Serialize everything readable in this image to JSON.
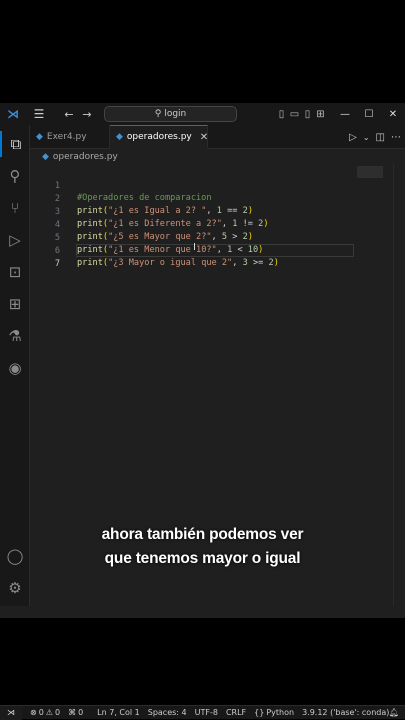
{
  "search": {
    "label": "login"
  },
  "tabs": [
    {
      "label": "Exer4.py",
      "active": false
    },
    {
      "label": "operadores.py",
      "active": true
    }
  ],
  "breadcrumb": {
    "file": "operadores.py"
  },
  "editor": {
    "lines": [
      {
        "num": "1",
        "text": "#Operadores de comparacion"
      },
      {
        "num": "2",
        "text": "print(\"¿1 es Igual a 2? \", 1 == 2)"
      },
      {
        "num": "3",
        "text": "print(\"¿1 es Diferente a 2?\", 1 != 2)"
      },
      {
        "num": "4",
        "text": "print(\"¿5 es Mayor que 2?\", 5 > 2)"
      },
      {
        "num": "5",
        "text": "print(\"¿1 es Menor que 10?\", 1 < 10)"
      },
      {
        "num": "6",
        "text": "print(\"¿3 Mayor o igual que 2\", 3 >= 2)"
      },
      {
        "num": "7",
        "text": ""
      }
    ]
  },
  "subtitle": {
    "line1": "ahora también podemos ver",
    "line2": "que tenemos mayor o igual"
  },
  "statusbar": {
    "errors": "0",
    "warnings": "0",
    "ports": "0",
    "position": "Ln 7, Col 1",
    "spaces": "Spaces: 4",
    "encoding": "UTF-8",
    "eol": "CRLF",
    "language": "Python",
    "interpreter": "3.9.12 ('base': conda)"
  },
  "colors": {
    "accent": "#0078d4",
    "comment": "#6a9955",
    "string": "#ce9178",
    "function": "#dcdcaa",
    "number": "#b5cea8"
  }
}
